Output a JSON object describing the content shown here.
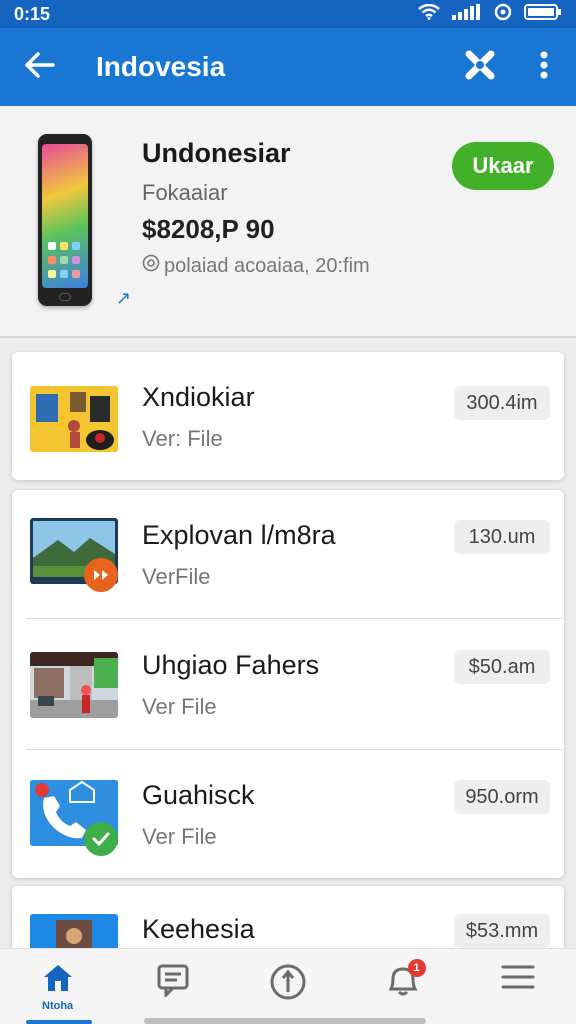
{
  "status_bar": {
    "time": "0:15"
  },
  "app_bar": {
    "title": "Indovesia"
  },
  "header": {
    "title": "Undonesiar",
    "subtitle": "Fokaaiar",
    "price": "$8208,P 90",
    "meta": "polaiad acoaiaa, 20:fim",
    "status_label": "Ukaar"
  },
  "items": [
    {
      "title": "Xndiokiar",
      "subtitle": "Ver: File",
      "size": "300.4im"
    },
    {
      "title": "Explovan l/m8ra",
      "subtitle": "VerFile",
      "size": "130.um"
    },
    {
      "title": "Uhgiao Fahers",
      "subtitle": "Ver File",
      "size": "$50.am"
    },
    {
      "title": "Guahisck",
      "subtitle": "Ver File",
      "size": "950.orm"
    },
    {
      "title": "Keehesia",
      "subtitle": "",
      "size": "$53.mm"
    }
  ],
  "bottom_nav": {
    "home_label": "Ntoha",
    "notification_count": "1"
  },
  "colors": {
    "primary": "#1976d2",
    "status_bar": "#1565c0",
    "status_green": "#43b02a",
    "badge_orange": "#e8641e",
    "badge_green": "#3fae49",
    "alert_red": "#e53935"
  },
  "icons": [
    "back-arrow-icon",
    "close-x-icon",
    "more-vert-icon",
    "wifi-icon",
    "signal-icon",
    "alarm-icon",
    "battery-icon",
    "home-icon",
    "chat-icon",
    "compass-icon",
    "notification-bell-icon",
    "menu-icon"
  ]
}
